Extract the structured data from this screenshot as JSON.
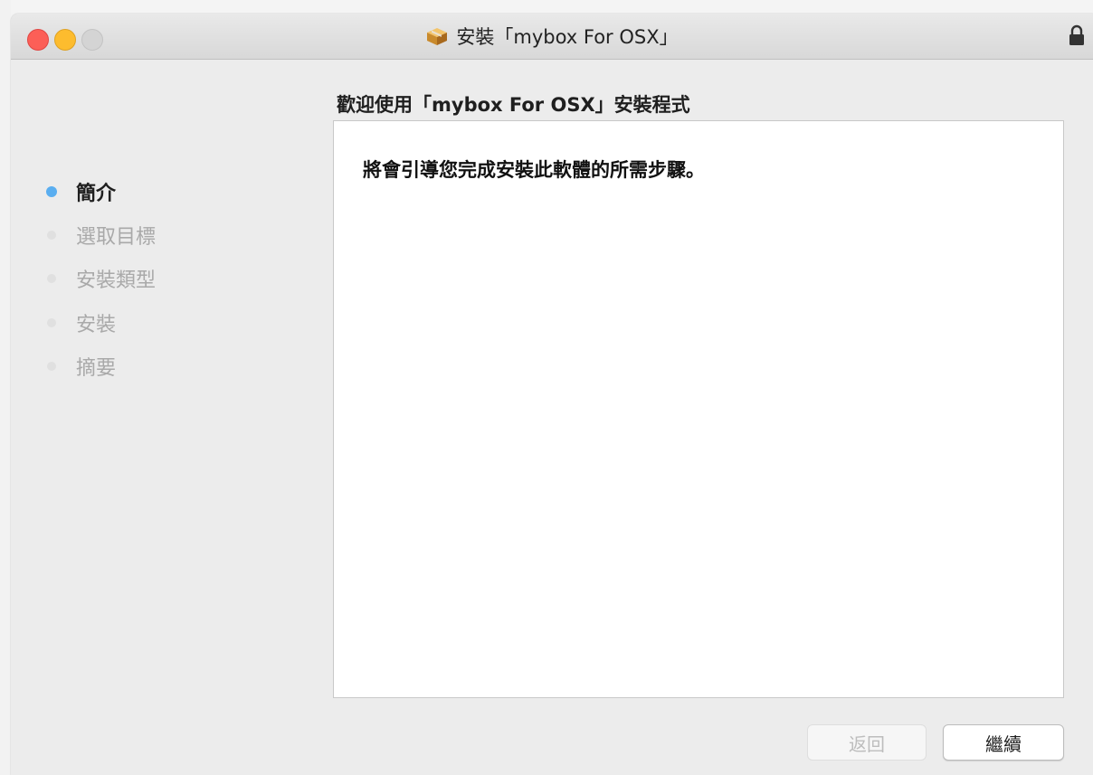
{
  "window": {
    "title": "安裝「mybox For OSX」",
    "package_icon": "package-icon",
    "lock_icon": "lock-icon"
  },
  "sidebar": {
    "steps": [
      {
        "label": "簡介",
        "active": true
      },
      {
        "label": "選取目標",
        "active": false
      },
      {
        "label": "安裝類型",
        "active": false
      },
      {
        "label": "安裝",
        "active": false
      },
      {
        "label": "摘要",
        "active": false
      }
    ]
  },
  "main": {
    "heading": "歡迎使用「mybox For OSX」安裝程式",
    "body_text": "將會引導您完成安裝此軟體的所需步驟。"
  },
  "buttons": {
    "back_label": "返回",
    "continue_label": "繼續"
  },
  "colors": {
    "active_step": "#5aaef0",
    "close": "#fc5f57",
    "minimize": "#fdbc2e"
  }
}
